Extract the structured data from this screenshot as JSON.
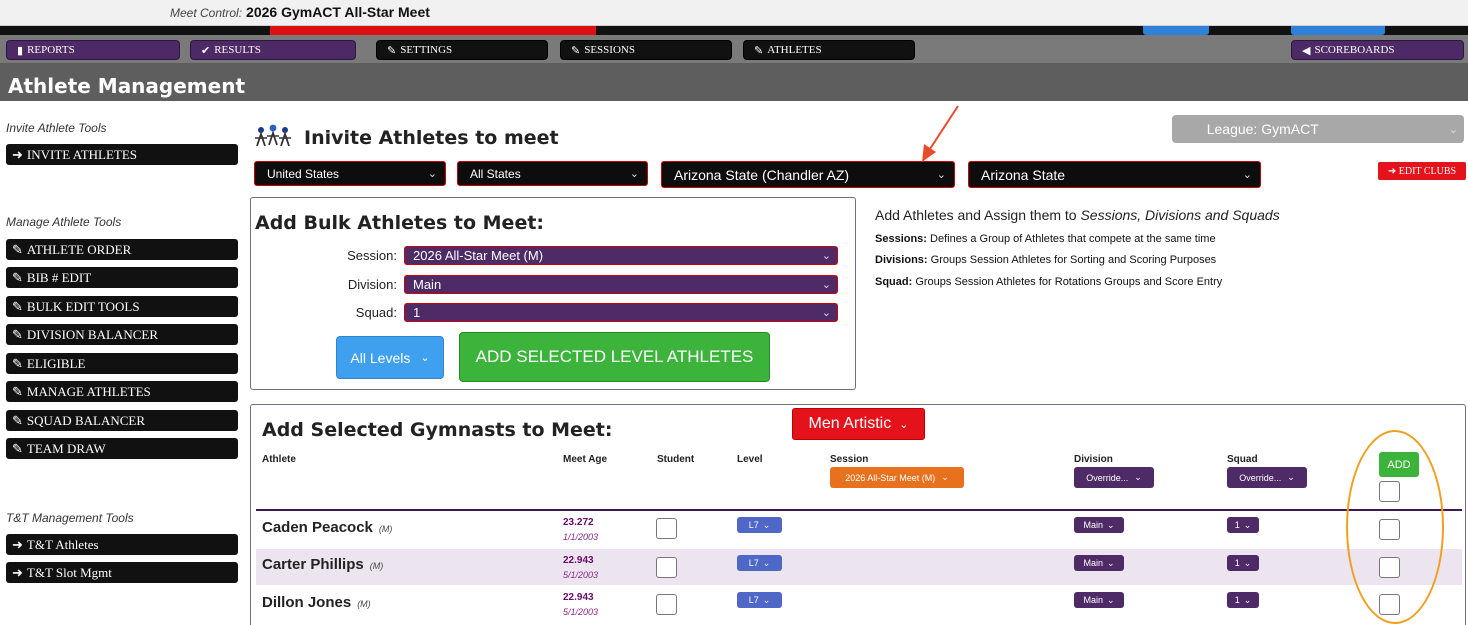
{
  "meet_control": {
    "label": "Meet Control:",
    "name": "2026 GymACT All-Star Meet"
  },
  "nav": {
    "reports": "REPORTS",
    "results": "RESULTS",
    "settings": "SETTINGS",
    "sessions": "SESSIONS",
    "athletes": "ATHLETES",
    "scoreboards": "SCOREBOARDS"
  },
  "page_title": "Athlete Management",
  "sidebar": {
    "invite_heading": "Invite Athlete Tools",
    "invite_items": [
      "INVITE ATHLETES"
    ],
    "manage_heading": "Manage Athlete Tools",
    "manage_items": [
      "ATHLETE ORDER",
      "BIB # EDIT",
      "BULK EDIT TOOLS",
      "DIVISION BALANCER",
      "ELIGIBLE",
      "MANAGE ATHLETES",
      "SQUAD BALANCER",
      "TEAM DRAW"
    ],
    "tt_heading": "T&T Management Tools",
    "tt_items": [
      "T&T Athletes",
      "T&T Slot Mgmt"
    ]
  },
  "invite": {
    "title": "Inivite Athletes to meet",
    "league": "League: GymACT",
    "country": "United States",
    "state": "All States",
    "club": "Arizona State (Chandler AZ)",
    "team": "Arizona State",
    "edit_clubs": "EDIT CLUBS"
  },
  "bulk": {
    "title": "Add Bulk Athletes to Meet:",
    "session_label": "Session:",
    "session_value": "2026 All-Star Meet (M)",
    "division_label": "Division:",
    "division_value": "Main",
    "squad_label": "Squad:",
    "squad_value": "1",
    "levels_button": "All Levels",
    "add_button": "ADD SELECTED LEVEL ATHLETES"
  },
  "info": {
    "heading_plain": "Add Athletes and Assign them to ",
    "heading_italic": "Sessions, Divisions and Squads",
    "lines": [
      {
        "term": "Sessions:",
        "text": " Defines a Group of Athletes that compete at the same time"
      },
      {
        "term": "Divisions:",
        "text": " Groups Session Athletes for Sorting and Scoring Purposes"
      },
      {
        "term": "Squad:",
        "text": " Groups Session Athletes for Rotations Groups and Score Entry"
      }
    ]
  },
  "selected": {
    "title": "Add Selected Gymnasts to Meet:",
    "discipline": "Men Artistic",
    "columns": {
      "athlete": "Athlete",
      "meet_age": "Meet Age",
      "student": "Student",
      "level": "Level",
      "session": "Session",
      "division": "Division",
      "squad": "Squad"
    },
    "session_select": "2026 All-Star Meet (M)",
    "division_override": "Override...",
    "squad_override": "Override...",
    "add_label": "ADD",
    "rows": [
      {
        "name": "Caden Peacock",
        "gender": "(M)",
        "age": "23.272",
        "dob": "1/1/2003",
        "level": "L7",
        "division": "Main",
        "squad": "1"
      },
      {
        "name": "Carter Phillips",
        "gender": "(M)",
        "age": "22.943",
        "dob": "5/1/2003",
        "level": "L7",
        "division": "Main",
        "squad": "1"
      },
      {
        "name": "Dillon Jones",
        "gender": "(M)",
        "age": "22.943",
        "dob": "5/1/2003",
        "level": "L7",
        "division": "Main",
        "squad": "1"
      }
    ]
  },
  "colors": {
    "purple": "#4e2b66",
    "green": "#3cb43c",
    "red": "#e3121b",
    "orange": "#e8711e",
    "highlight": "#f0a020"
  }
}
